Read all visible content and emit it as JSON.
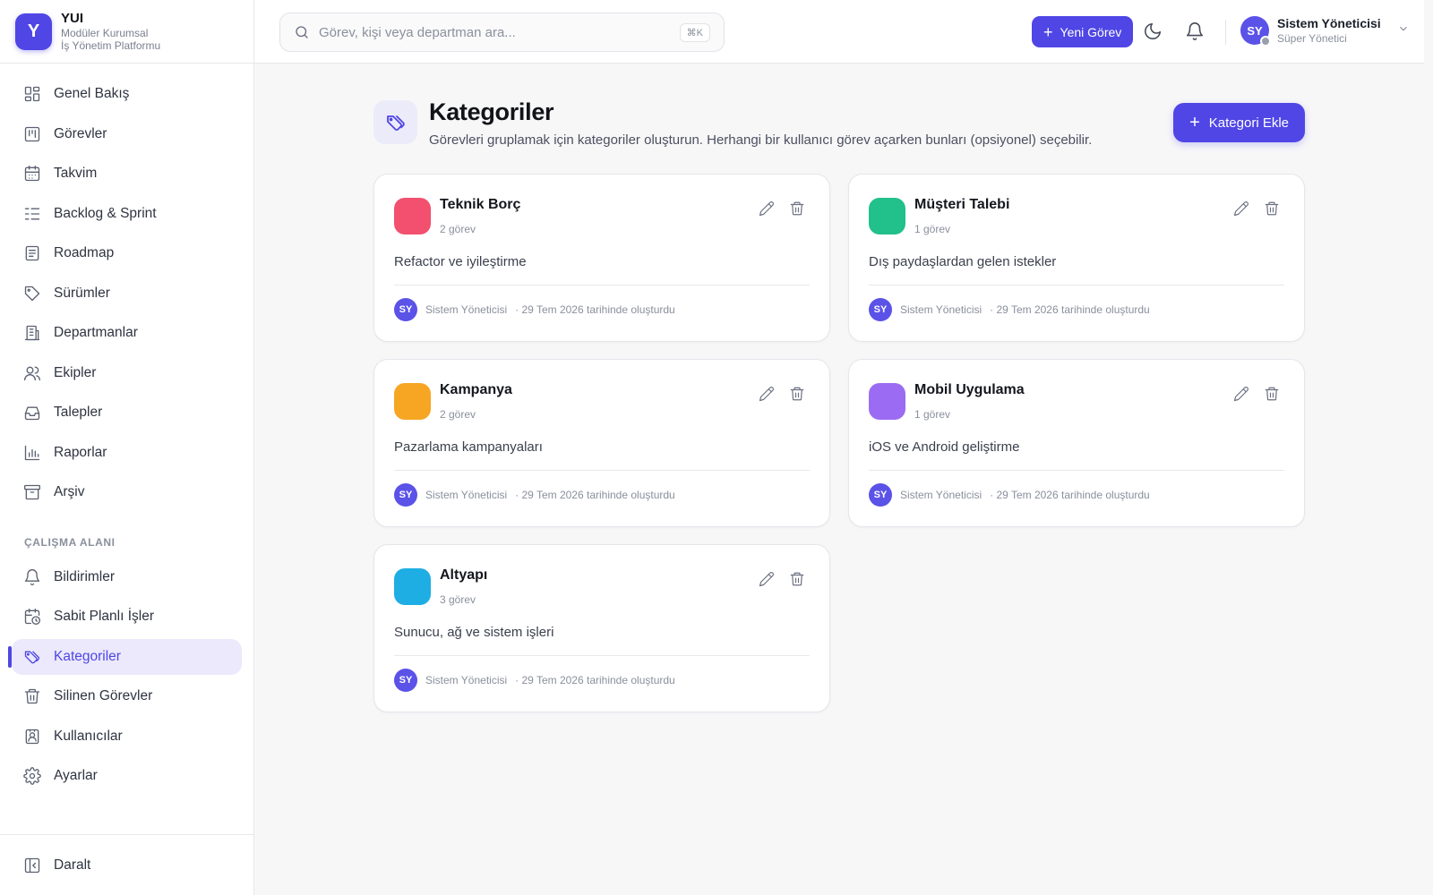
{
  "brand": {
    "logo": "Y",
    "name": "YUI",
    "sub1": "Modüler Kurumsal",
    "sub2": "İş Yönetim Platformu"
  },
  "nav": {
    "items": [
      {
        "label": "Genel Bakış",
        "icon": "dashboard-icon"
      },
      {
        "label": "Görevler",
        "icon": "board-icon"
      },
      {
        "label": "Takvim",
        "icon": "calendar-icon"
      },
      {
        "label": "Backlog & Sprint",
        "icon": "list-tree-icon"
      },
      {
        "label": "Roadmap",
        "icon": "roadmap-icon"
      },
      {
        "label": "Sürümler",
        "icon": "tag-icon"
      },
      {
        "label": "Departmanlar",
        "icon": "building-icon"
      },
      {
        "label": "Ekipler",
        "icon": "users-icon"
      },
      {
        "label": "Talepler",
        "icon": "inbox-icon"
      },
      {
        "label": "Raporlar",
        "icon": "bar-chart-icon"
      },
      {
        "label": "Arşiv",
        "icon": "archive-icon"
      }
    ],
    "section_label": "ÇALIŞMA ALANI",
    "workspace": [
      {
        "label": "Bildirimler",
        "icon": "bell-icon"
      },
      {
        "label": "Sabit Planlı İşler",
        "icon": "calendar-clock-icon"
      },
      {
        "label": "Kategoriler",
        "icon": "tags-icon",
        "active": true
      },
      {
        "label": "Silinen Görevler",
        "icon": "trash-icon"
      },
      {
        "label": "Kullanıcılar",
        "icon": "contact-icon"
      },
      {
        "label": "Ayarlar",
        "icon": "gear-icon"
      }
    ],
    "collapse_label": "Daralt"
  },
  "topbar": {
    "search_placeholder": "Görev, kişi veya departman ara...",
    "shortcut": "⌘K",
    "new_task_label": "Yeni Görev",
    "user": {
      "initials": "SY",
      "name": "Sistem Yöneticisi",
      "role": "Süper Yönetici"
    }
  },
  "page": {
    "title": "Kategoriler",
    "description": "Görevleri gruplamak için kategoriler oluşturun. Herhangi bir kullanıcı görev açarken bunları (opsiyonel) seçebilir.",
    "add_label": "Kategori Ekle"
  },
  "categories": [
    {
      "name": "Teknik Borç",
      "count": "2 görev",
      "description": "Refactor ve iyileştirme",
      "color": "#f2506e",
      "author_initials": "SY",
      "author": "Sistem Yöneticisi",
      "created": "· 29 Tem 2026 tarihinde oluşturdu"
    },
    {
      "name": "Müşteri Talebi",
      "count": "1 görev",
      "description": "Dış paydaşlardan gelen istekler",
      "color": "#22c08b",
      "author_initials": "SY",
      "author": "Sistem Yöneticisi",
      "created": "· 29 Tem 2026 tarihinde oluşturdu"
    },
    {
      "name": "Kampanya",
      "count": "2 görev",
      "description": "Pazarlama kampanyaları",
      "color": "#f6a623",
      "author_initials": "SY",
      "author": "Sistem Yöneticisi",
      "created": "· 29 Tem 2026 tarihinde oluşturdu"
    },
    {
      "name": "Mobil Uygulama",
      "count": "1 görev",
      "description": "iOS ve Android geliştirme",
      "color": "#9b6cf3",
      "author_initials": "SY",
      "author": "Sistem Yöneticisi",
      "created": "· 29 Tem 2026 tarihinde oluşturdu"
    },
    {
      "name": "Altyapı",
      "count": "3 görev",
      "description": "Sunucu, ağ ve sistem işleri",
      "color": "#1eaee4",
      "author_initials": "SY",
      "author": "Sistem Yöneticisi",
      "created": "· 29 Tem 2026 tarihinde oluşturdu"
    }
  ],
  "colors": {
    "accent": "#4f46e5",
    "accent_soft": "#ebe9fb"
  }
}
